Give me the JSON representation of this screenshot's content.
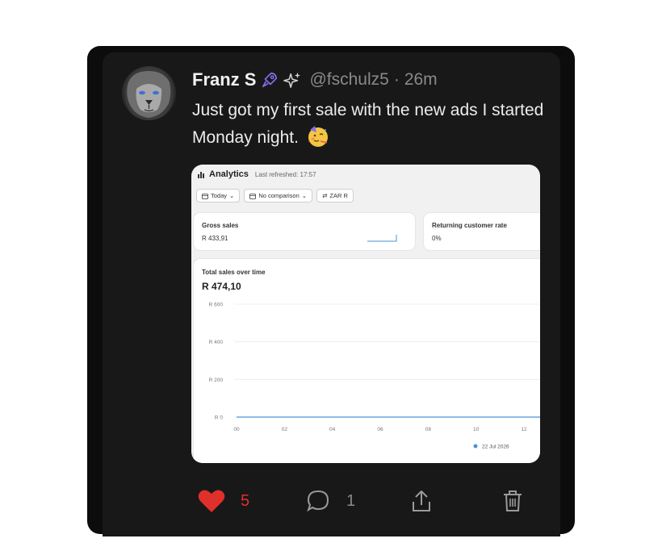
{
  "post": {
    "author_name": "Franz S",
    "handle": "@fschulz5",
    "separator": "·",
    "time": "26m",
    "text": "Just got my first sale with the new ads I started Monday night.",
    "badges": [
      "rocket-badge-icon",
      "sparkle-badge-icon"
    ],
    "emoji": "partying-face-emoji",
    "likes": "5",
    "replies": "1"
  },
  "analytics": {
    "title": "Analytics",
    "refreshed": "Last refreshed: 17:57",
    "filters": {
      "date": "Today",
      "comparison": "No comparison",
      "currency": "ZAR R"
    },
    "gross_sales": {
      "label": "Gross sales",
      "value": "R 433,91"
    },
    "returning_rate": {
      "label": "Returning customer rate",
      "value": "0%"
    },
    "total_sales": {
      "label": "Total sales over time",
      "value": "R 474,10"
    }
  },
  "chart_data": {
    "type": "line",
    "title": "Total sales over time",
    "x": [
      "00",
      "02",
      "04",
      "06",
      "08",
      "10",
      "12"
    ],
    "y_ticks": [
      "R 600",
      "R 400",
      "R 200",
      "R 0"
    ],
    "ylim": [
      0,
      600
    ],
    "series": [
      {
        "name": "22 Jul 2026",
        "values": [
          0,
          0,
          0,
          0,
          0,
          0,
          0
        ],
        "color": "#4a90d9"
      }
    ],
    "grid": true,
    "legend_position": "bottom-right"
  },
  "colors": {
    "background": "#181818",
    "like": "#e0302b",
    "muted": "#8a8a8a",
    "accent_badge": "#8b6cf0"
  }
}
